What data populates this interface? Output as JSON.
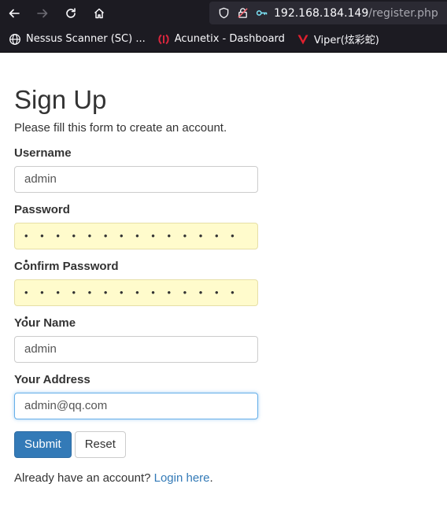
{
  "browser": {
    "url_host": "192.168.184.149",
    "url_path": "/register.php",
    "bookmarks": [
      {
        "label": "Nessus Scanner (SC) ...",
        "icon": "globe-icon"
      },
      {
        "label": "Acunetix - Dashboard",
        "icon": "acunetix-icon"
      },
      {
        "label": "Viper(炫彩蛇)",
        "icon": "viper-icon"
      }
    ]
  },
  "page": {
    "title": "Sign Up",
    "subtitle": "Please fill this form to create an account.",
    "fields": {
      "username": {
        "label": "Username",
        "value": "admin"
      },
      "password": {
        "label": "Password",
        "value": "• • • • • • • • • • • • • • •"
      },
      "confirm_password": {
        "label": "Confirm Password",
        "value": "• • • • • • • • • • • • • • •"
      },
      "name": {
        "label": "Your Name",
        "value": "admin"
      },
      "address": {
        "label": "Your Address",
        "value": "admin@qq.com"
      }
    },
    "submit_label": "Submit",
    "reset_label": "Reset",
    "login_prompt": "Already have an account?",
    "login_link": "Login here",
    "login_suffix": "."
  }
}
